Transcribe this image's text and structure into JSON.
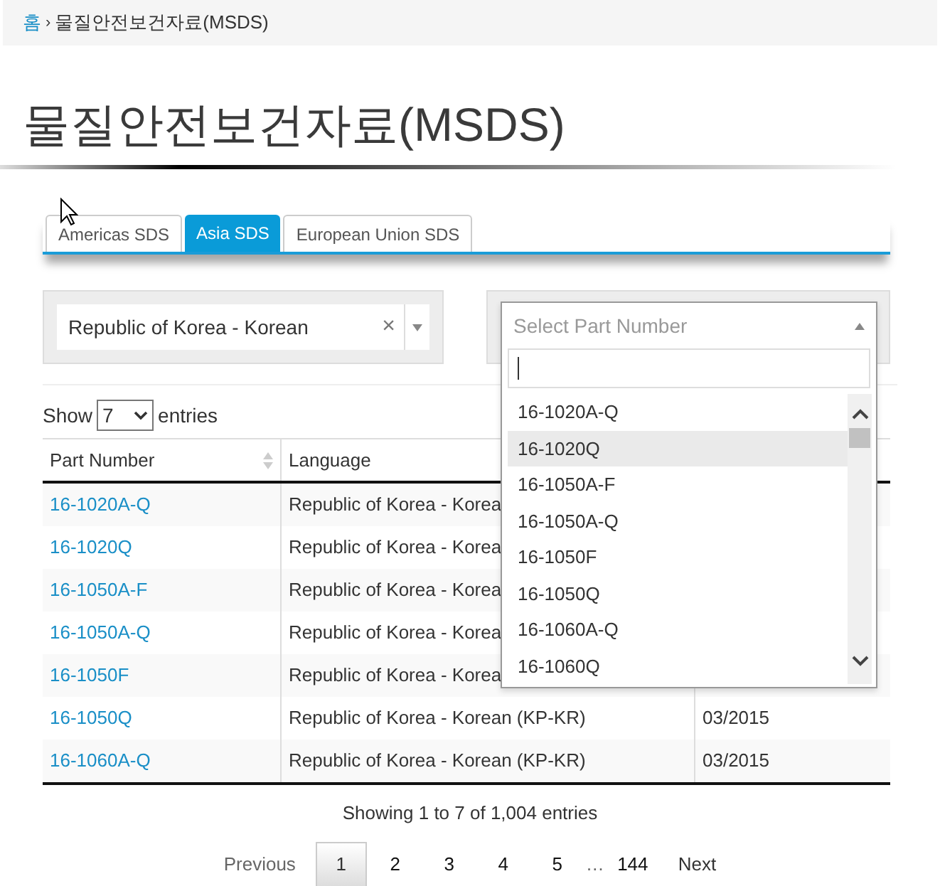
{
  "breadcrumb": {
    "home": "홈",
    "separator": "›",
    "current": "물질안전보건자료(MSDS)"
  },
  "title": "물질안전보건자료(MSDS)",
  "tabs": [
    {
      "label": "Americas SDS",
      "selected": false
    },
    {
      "label": "Asia SDS",
      "selected": true
    },
    {
      "label": "European Union SDS",
      "selected": false
    }
  ],
  "language_filter": {
    "value": "Republic of Korea - Korean",
    "clear": "×"
  },
  "part_filter": {
    "placeholder": "Select Part Number",
    "expanded": true,
    "options": [
      {
        "label": "16-1020A-Q",
        "selected": false
      },
      {
        "label": "16-1020Q",
        "selected": true
      },
      {
        "label": "16-1050A-F",
        "selected": false
      },
      {
        "label": "16-1050A-Q",
        "selected": false
      },
      {
        "label": "16-1050F",
        "selected": false
      },
      {
        "label": "16-1050Q",
        "selected": false
      },
      {
        "label": "16-1060A-Q",
        "selected": false
      },
      {
        "label": "16-1060Q",
        "selected": false
      }
    ]
  },
  "length": {
    "show": "Show",
    "value": "7",
    "entries": "entries"
  },
  "table": {
    "columns": [
      "Part Number",
      "Language"
    ],
    "rows": [
      {
        "part": "16-1020A-Q",
        "language": "Republic of Korea - Korea"
      },
      {
        "part": "16-1020Q",
        "language": "Republic of Korea - Korea"
      },
      {
        "part": "16-1050A-F",
        "language": "Republic of Korea - Korea"
      },
      {
        "part": "16-1050A-Q",
        "language": "Republic of Korea - Korea"
      },
      {
        "part": "16-1050F",
        "language": "Republic of Korea - Korea"
      },
      {
        "part": "16-1050Q",
        "language": "Republic of Korea - Korean (KP-KR)",
        "date": "03/2015"
      },
      {
        "part": "16-1060A-Q",
        "language": "Republic of Korea - Korean (KP-KR)",
        "date": "03/2015"
      }
    ]
  },
  "info": "Showing 1 to 7 of 1,004 entries",
  "pagination": {
    "previous": "Previous",
    "pages": [
      {
        "label": "1",
        "selected": true
      },
      {
        "label": "2",
        "selected": false
      },
      {
        "label": "3",
        "selected": false
      },
      {
        "label": "4",
        "selected": false
      },
      {
        "label": "5",
        "selected": false
      },
      {
        "label": "…",
        "kind": "ellipsis"
      },
      {
        "label": "144",
        "selected": false
      }
    ],
    "next": "Next"
  }
}
